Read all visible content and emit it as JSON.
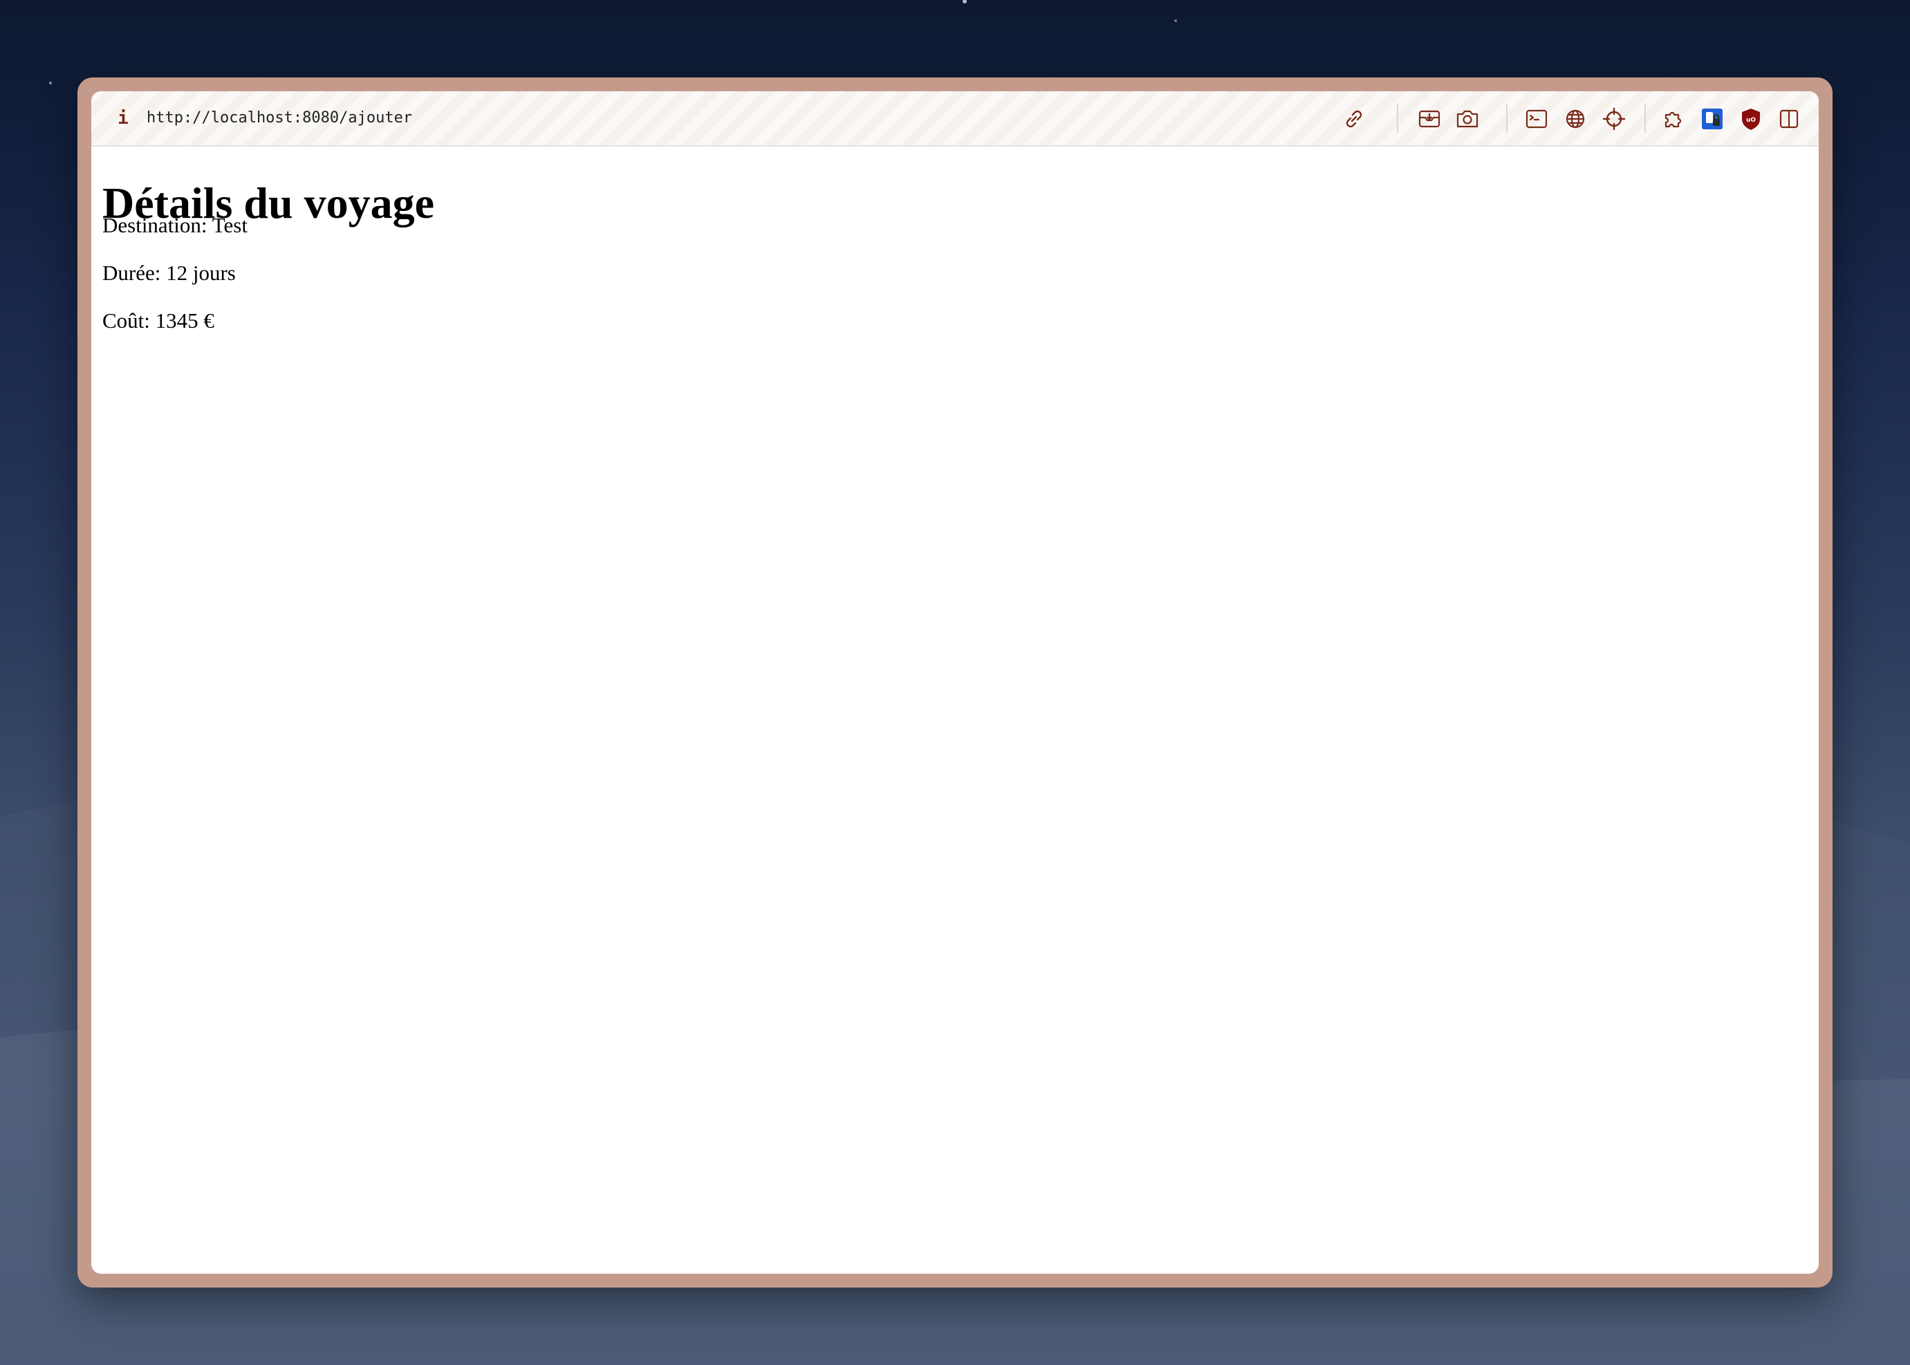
{
  "browser": {
    "url": "http://localhost:8080/ajouter",
    "info_icon_glyph": "i",
    "toolbar_icons": [
      "link-icon",
      "save-page-icon",
      "screenshot-camera-icon",
      "console-icon",
      "globe-icon",
      "crosshair-icon",
      "extensions-puzzle-icon",
      "password-manager-icon",
      "ublock-origin-icon",
      "sidebar-toggle-icon"
    ],
    "colors": {
      "frame": "#c49b8a",
      "icon": "#7a2a1a",
      "ublock_red": "#8b0f0f",
      "password_blue": "#1f5fd6"
    }
  },
  "page": {
    "title": "Détails du voyage",
    "destination_line": "Destination: Test",
    "duration_line": "Durée: 12 jours",
    "cost_line": "Coût: 1345 €"
  }
}
